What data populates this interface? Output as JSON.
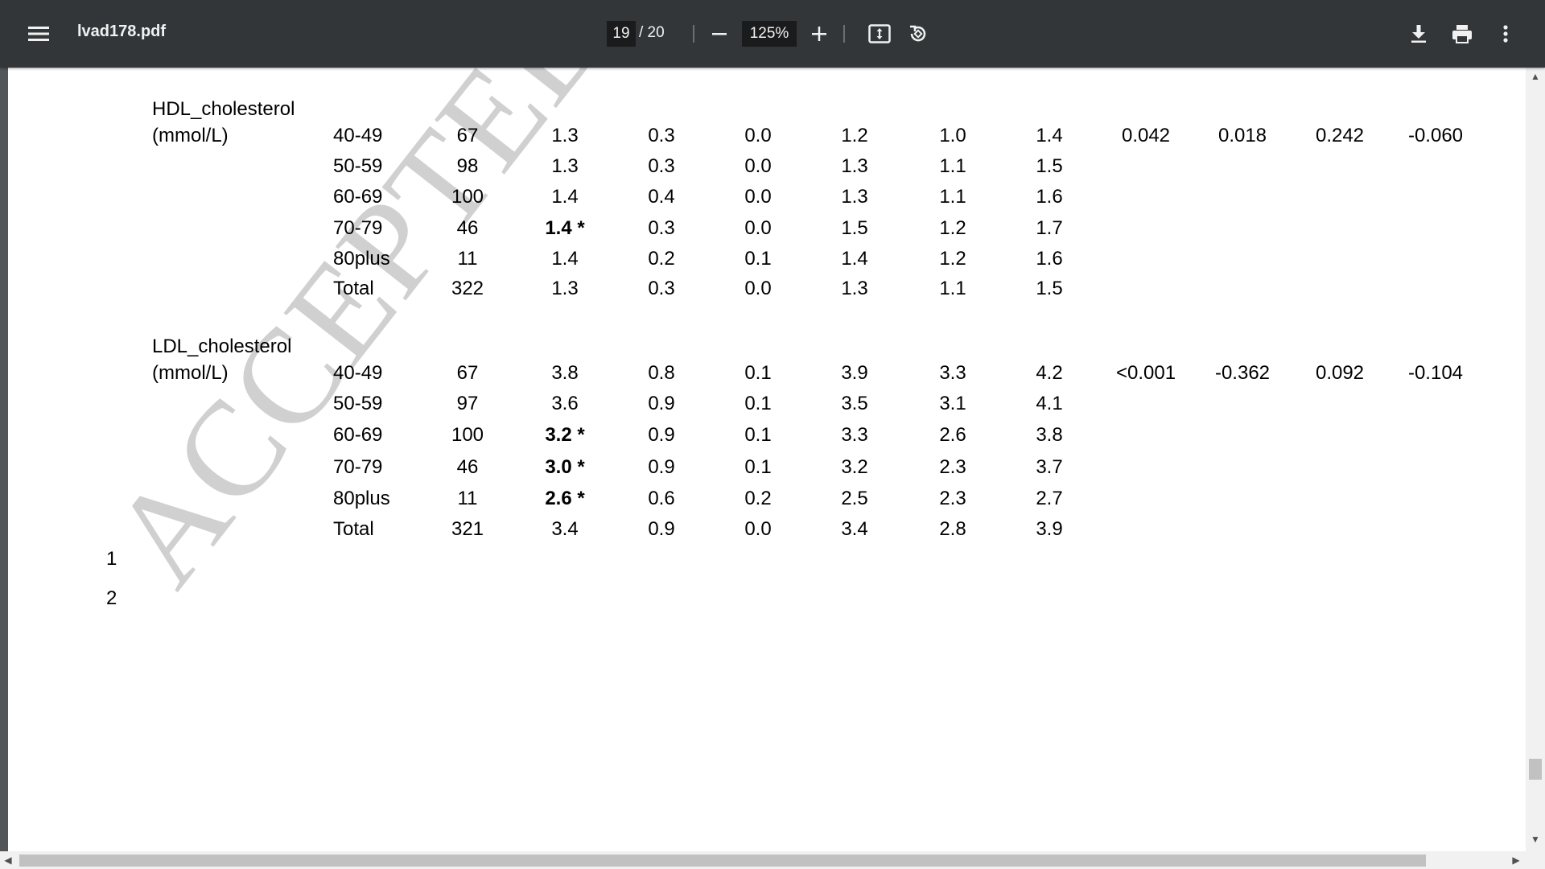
{
  "toolbar": {
    "title": "lvad178.pdf",
    "page_current": "19",
    "page_total": "/ 20",
    "zoom": "125%"
  },
  "icons": {
    "menu": "menu-icon",
    "zoom_out": "minus-icon",
    "zoom_in": "plus-icon",
    "fit": "fit-to-page-icon",
    "rotate": "rotate-icon",
    "download": "download-icon",
    "print": "print-icon",
    "more": "more-vert-icon"
  },
  "document": {
    "watermark": "ACCEPTED MANUSCRIPT",
    "hdl": {
      "label1": "HDL_cholesterol",
      "label2": "(mmol/L)",
      "rows": [
        {
          "age": "40-49",
          "n": "67",
          "mean": "1.3",
          "sd": "0.3",
          "se": "0.0",
          "median": "1.2",
          "q1": "1.0",
          "q3": "1.4",
          "p": "0.042",
          "c1": "0.018",
          "c2": "0.242",
          "c3": "-0.060"
        },
        {
          "age": "50-59",
          "n": "98",
          "mean": "1.3",
          "sd": "0.3",
          "se": "0.0",
          "median": "1.3",
          "q1": "1.1",
          "q3": "1.5"
        },
        {
          "age": "60-69",
          "n": "100",
          "mean": "1.4",
          "sd": "0.4",
          "se": "0.0",
          "median": "1.3",
          "q1": "1.1",
          "q3": "1.6"
        },
        {
          "age": "70-79",
          "n": "46",
          "mean": "1.4 *",
          "sd": "0.3",
          "se": "0.0",
          "median": "1.5",
          "q1": "1.2",
          "q3": "1.7"
        },
        {
          "age": "80plus",
          "n": "11",
          "mean": "1.4",
          "sd": "0.2",
          "se": "0.1",
          "median": "1.4",
          "q1": "1.2",
          "q3": "1.6"
        },
        {
          "age": "Total",
          "n": "322",
          "mean": "1.3",
          "sd": "0.3",
          "se": "0.0",
          "median": "1.3",
          "q1": "1.1",
          "q3": "1.5"
        }
      ]
    },
    "ldl": {
      "label1": "LDL_cholesterol",
      "label2": "(mmol/L)",
      "rows": [
        {
          "age": "40-49",
          "n": "67",
          "mean": "3.8",
          "sd": "0.8",
          "se": "0.1",
          "median": "3.9",
          "q1": "3.3",
          "q3": "4.2",
          "p": "<0.001",
          "c1": "-0.362",
          "c2": "0.092",
          "c3": "-0.104"
        },
        {
          "age": "50-59",
          "n": "97",
          "mean": "3.6",
          "sd": "0.9",
          "se": "0.1",
          "median": "3.5",
          "q1": "3.1",
          "q3": "4.1"
        },
        {
          "age": "60-69",
          "n": "100",
          "mean": "3.2 *",
          "sd": "0.9",
          "se": "0.1",
          "median": "3.3",
          "q1": "2.6",
          "q3": "3.8"
        },
        {
          "age": "70-79",
          "n": "46",
          "mean": "3.0 *",
          "sd": "0.9",
          "se": "0.1",
          "median": "3.2",
          "q1": "2.3",
          "q3": "3.7"
        },
        {
          "age": "80plus",
          "n": "11",
          "mean": "2.6 *",
          "sd": "0.6",
          "se": "0.2",
          "median": "2.5",
          "q1": "2.3",
          "q3": "2.7"
        },
        {
          "age": "Total",
          "n": "321",
          "mean": "3.4",
          "sd": "0.9",
          "se": "0.0",
          "median": "3.4",
          "q1": "2.8",
          "q3": "3.9"
        }
      ]
    },
    "line_numbers": [
      "1",
      "2"
    ]
  }
}
